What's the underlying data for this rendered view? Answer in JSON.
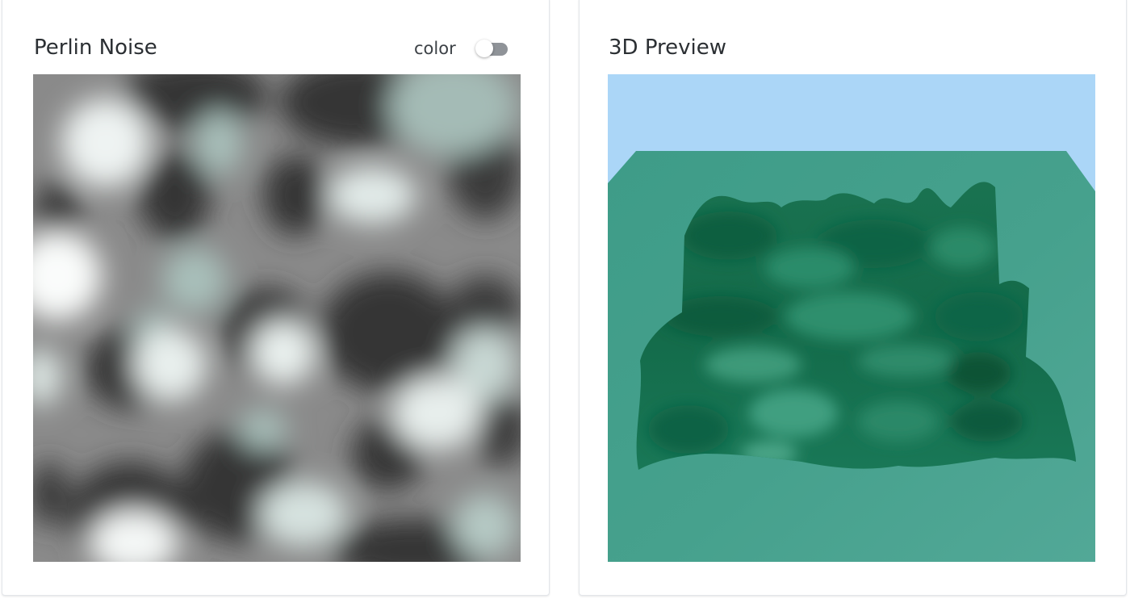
{
  "left_panel": {
    "title": "Perlin Noise",
    "color_toggle": {
      "label": "color",
      "state": "off"
    }
  },
  "right_panel": {
    "title": "3D Preview"
  },
  "colors": {
    "noise_dark": "#333333",
    "noise_mid": "#8a8a8a",
    "noise_light": "#ffffff",
    "noise_tint": "#9eb8b3",
    "sky": "#abd6f7",
    "terrain_plane": "#43a08c",
    "terrain_shadow": "#0c6141",
    "terrain_mid": "#1f7a58",
    "toggle_track": "#8f9398"
  },
  "icons": {
    "toggle": "toggle-switch-icon"
  }
}
